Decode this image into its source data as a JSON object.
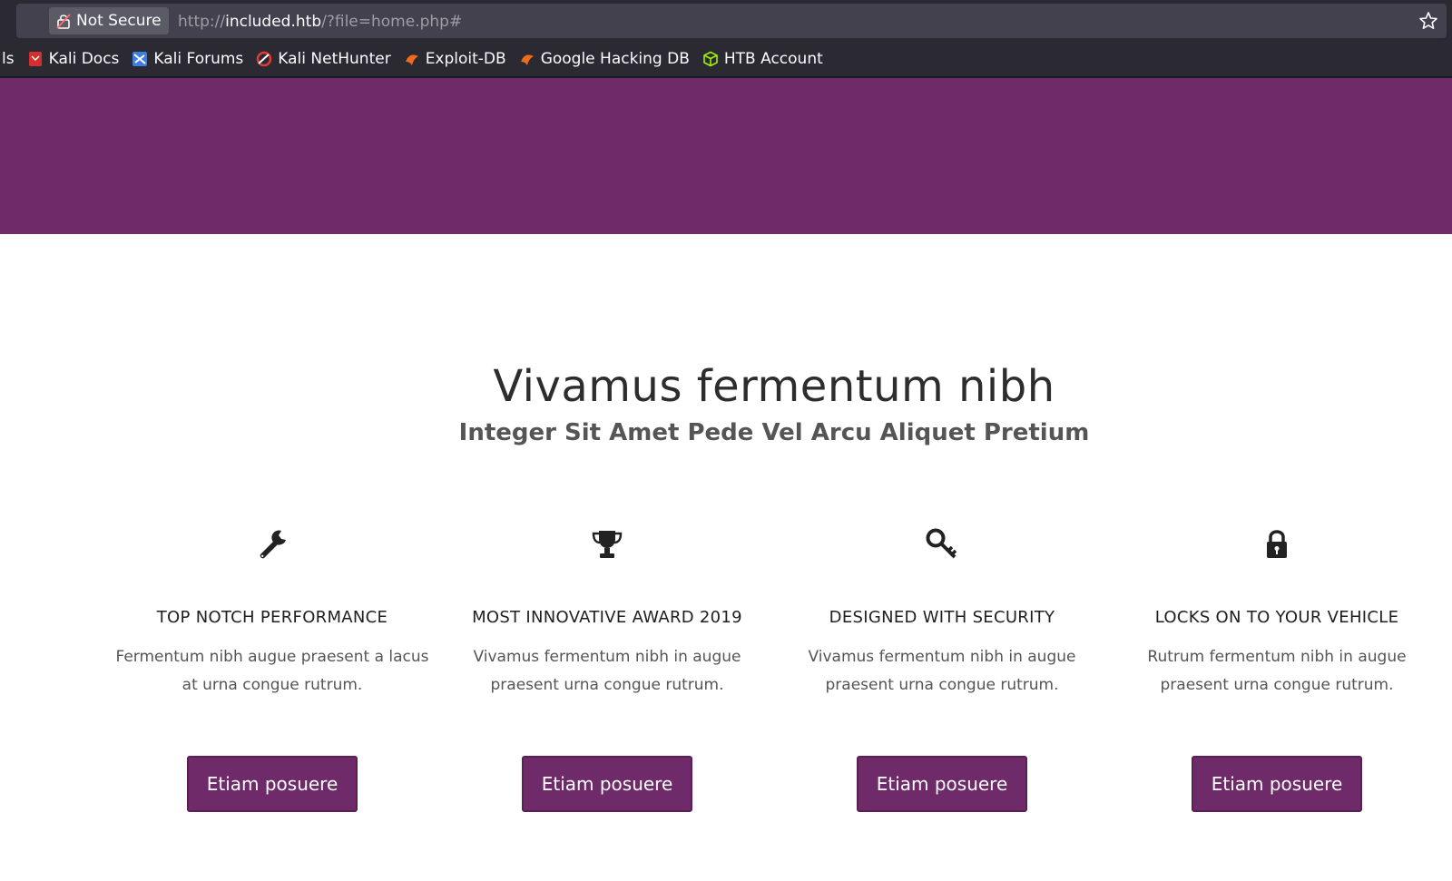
{
  "browser": {
    "security_label": "Not Secure",
    "url_scheme": "http://",
    "url_host": "included.htb",
    "url_path": "/?file=home.php#",
    "bookmarks": {
      "partial_label": "ls",
      "items": [
        {
          "label": "Kali Docs",
          "icon": "kali-docs-icon"
        },
        {
          "label": "Kali Forums",
          "icon": "kali-forums-icon"
        },
        {
          "label": "Kali NetHunter",
          "icon": "kali-nethunter-icon"
        },
        {
          "label": "Exploit-DB",
          "icon": "exploit-db-icon"
        },
        {
          "label": "Google Hacking DB",
          "icon": "google-hacking-db-icon"
        },
        {
          "label": "HTB Account",
          "icon": "htb-cube-icon"
        }
      ]
    }
  },
  "page": {
    "brand_color": "#6f2a69",
    "headline": "Vivamus fermentum nibh",
    "subheadline": "Integer Sit Amet Pede Vel Arcu Aliquet Pretium",
    "features": [
      {
        "icon": "wrench-icon",
        "title": "TOP NOTCH PERFORMANCE",
        "text": "Fermentum nibh augue praesent a lacus at urna congue rutrum.",
        "button": "Etiam posuere"
      },
      {
        "icon": "trophy-icon",
        "title": "MOST INNOVATIVE AWARD 2019",
        "text": "Vivamus fermentum nibh in augue praesent urna congue rutrum.",
        "button": "Etiam posuere"
      },
      {
        "icon": "key-icon",
        "title": "DESIGNED WITH SECURITY",
        "text": "Vivamus fermentum nibh in augue praesent urna congue rutrum.",
        "button": "Etiam posuere"
      },
      {
        "icon": "padlock-icon",
        "title": "LOCKS ON TO YOUR VEHICLE",
        "text": "Rutrum fermentum nibh in augue praesent urna congue rutrum.",
        "button": "Etiam posuere"
      }
    ]
  }
}
